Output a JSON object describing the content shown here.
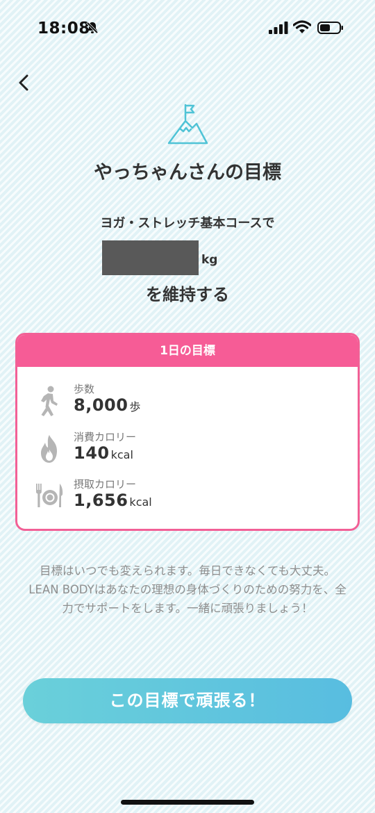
{
  "status_bar": {
    "time": "18:08",
    "icons": [
      "bell-slash-icon",
      "cellular-signal-icon",
      "wifi-icon",
      "battery-icon"
    ]
  },
  "header": {
    "back_icon": "chevron-left-icon",
    "goal_icon": "mountain-flag-icon",
    "title": "やっちゃんさんの目標"
  },
  "goal": {
    "course_line": "ヨガ・ストレッチ基本コースで",
    "weight_value_redacted": true,
    "weight_unit": "kg",
    "maintain_text": "を維持する"
  },
  "daily_goal": {
    "header": "1日の目標",
    "metrics": [
      {
        "icon": "walking-person-icon",
        "label": "歩数",
        "value": "8,000",
        "unit": "歩"
      },
      {
        "icon": "flame-icon",
        "label": "消費カロリー",
        "value": "140",
        "unit": "kcal"
      },
      {
        "icon": "fork-plate-knife-icon",
        "label": "摂取カロリー",
        "value": "1,656",
        "unit": "kcal"
      }
    ]
  },
  "note": "目標はいつでも変えられます。毎日できなくても大丈夫。LEAN BODYはあなたの理想の身体づくりのための努力を、全力でサポートをします。一緒に頑張りましょう！",
  "cta": {
    "label": "この目標で頑張る！"
  },
  "colors": {
    "accent_pink": "#f65c96",
    "accent_teal": "#5cc8dc",
    "icon_teal": "#4fc3d6",
    "background": "#eef8fa"
  }
}
